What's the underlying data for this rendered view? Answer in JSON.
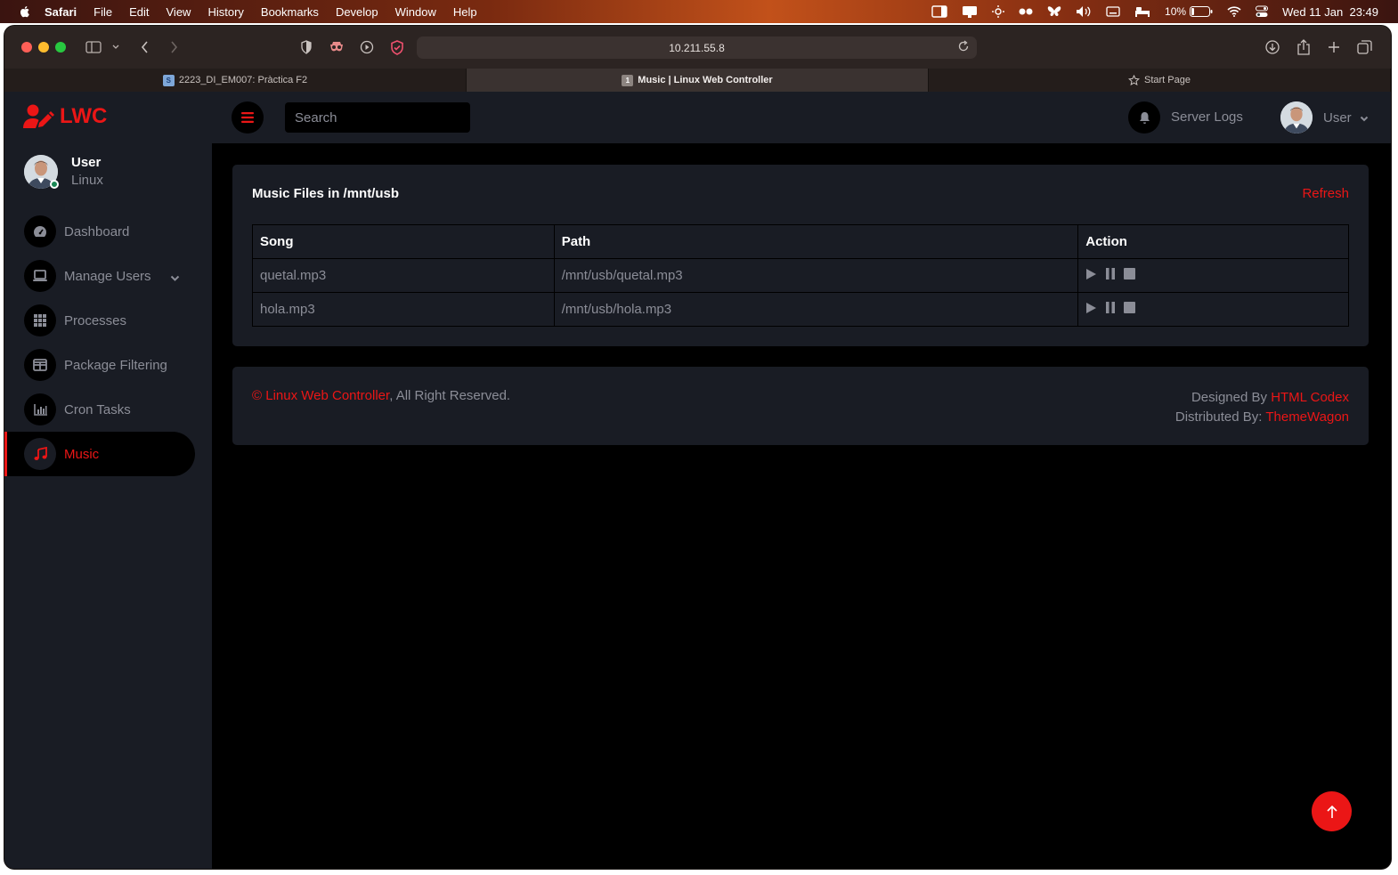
{
  "menubar": {
    "app": "Safari",
    "items": [
      "File",
      "Edit",
      "View",
      "History",
      "Bookmarks",
      "Develop",
      "Window",
      "Help"
    ],
    "battery": "10%",
    "datetime": "Wed 11 Jan  23:49"
  },
  "browser": {
    "url": "10.211.55.8",
    "tabs": [
      {
        "label": "2223_DI_EM007: Pràctica F2",
        "favicon": "S"
      },
      {
        "label": "Music | Linux Web Controller",
        "favicon": "1"
      },
      {
        "label": "Start Page",
        "favicon": "star-icon"
      }
    ]
  },
  "sidebar": {
    "brand": "LWC",
    "user": {
      "name": "User",
      "role": "Linux"
    },
    "items": [
      {
        "label": "Dashboard",
        "icon": "gauge-icon"
      },
      {
        "label": "Manage Users",
        "icon": "laptop-icon"
      },
      {
        "label": "Processes",
        "icon": "grid-icon"
      },
      {
        "label": "Package Filtering",
        "icon": "table-icon"
      },
      {
        "label": "Cron Tasks",
        "icon": "chart-icon"
      },
      {
        "label": "Music",
        "icon": "music-icon"
      }
    ]
  },
  "topbar": {
    "search_placeholder": "Search",
    "server_logs": "Server Logs",
    "user": "User"
  },
  "main": {
    "card_title": "Music Files in /mnt/usb",
    "refresh": "Refresh",
    "columns": [
      "Song",
      "Path",
      "Action"
    ],
    "rows": [
      {
        "song": "quetal.mp3",
        "path": "/mnt/usb/quetal.mp3"
      },
      {
        "song": "hola.mp3",
        "path": "/mnt/usb/hola.mp3"
      }
    ]
  },
  "footer": {
    "copyright_symbol": "©",
    "site_link": "Linux Web Controller",
    "rights": ", All Right Reserved.",
    "designed_by": "Designed By",
    "designer_link": "HTML Codex",
    "distributed_by": "Distributed By:",
    "distributor_link": "ThemeWagon"
  },
  "colors": {
    "accent": "#eb1616",
    "panel": "#191c24",
    "background": "#000000",
    "muted_text": "#8b8d97"
  }
}
